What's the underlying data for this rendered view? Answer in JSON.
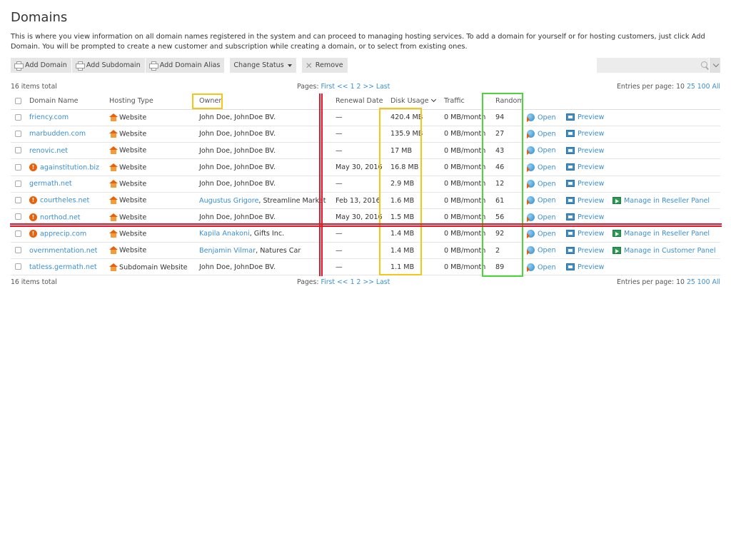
{
  "page": {
    "title": "Domains",
    "description": "This is where you view information on all domain names registered in the system and can proceed to managing hosting services. To add a domain for yourself or for hosting customers, just click Add Domain. You will be prompted to create a new customer and subscription while creating a domain, or to select from existing ones."
  },
  "toolbar": {
    "add_domain": "Add Domain",
    "add_subdomain": "Add Subdomain",
    "add_domain_alias": "Add Domain Alias",
    "change_status": "Change Status",
    "remove": "Remove"
  },
  "search": {
    "placeholder": ""
  },
  "summary": {
    "total": "16 items total",
    "pages_label": "Pages:",
    "first": "First",
    "prev": "<<",
    "page1": "1",
    "page2": "2",
    "next": ">>",
    "last": "Last",
    "entries_label": "Entries per page:",
    "e10": "10",
    "e25": "25",
    "e100": "100",
    "eall": "All"
  },
  "columns": {
    "domain": "Domain Name",
    "hosting": "Hosting Type",
    "owner": "Owner",
    "renewal": "Renewal Date",
    "disk": "Disk Usage",
    "traffic": "Traffic",
    "random": "Random"
  },
  "actions": {
    "open": "Open",
    "preview": "Preview"
  },
  "rows": [
    {
      "domain": "friency.com",
      "alert": false,
      "hosting": "Website",
      "owner_link": "",
      "owner_text": "John Doe, JohnDoe BV.",
      "renewal": "—",
      "disk": "420.4 MB",
      "traffic": "0 MB/month",
      "random": "94",
      "manage": ""
    },
    {
      "domain": "marbudden.com",
      "alert": false,
      "hosting": "Website",
      "owner_link": "",
      "owner_text": "John Doe, JohnDoe BV.",
      "renewal": "—",
      "disk": "135.9 MB",
      "traffic": "0 MB/month",
      "random": "27",
      "manage": ""
    },
    {
      "domain": "renovic.net",
      "alert": false,
      "hosting": "Website",
      "owner_link": "",
      "owner_text": "John Doe, JohnDoe BV.",
      "renewal": "—",
      "disk": "17 MB",
      "traffic": "0 MB/month",
      "random": "43",
      "manage": ""
    },
    {
      "domain": "againstitution.biz",
      "alert": true,
      "hosting": "Website",
      "owner_link": "",
      "owner_text": "John Doe, JohnDoe BV.",
      "renewal": "May 30, 2016",
      "disk": "16.8 MB",
      "traffic": "0 MB/month",
      "random": "46",
      "manage": ""
    },
    {
      "domain": "germath.net",
      "alert": false,
      "hosting": "Website",
      "owner_link": "",
      "owner_text": "John Doe, JohnDoe BV.",
      "renewal": "—",
      "disk": "2.9 MB",
      "traffic": "0 MB/month",
      "random": "12",
      "manage": ""
    },
    {
      "domain": "courtheles.net",
      "alert": true,
      "hosting": "Website",
      "owner_link": "Augustus Grigore",
      "owner_text": ", Streamline Market",
      "renewal": "Feb 13, 2016",
      "disk": "1.6 MB",
      "traffic": "0 MB/month",
      "random": "61",
      "manage": "Manage in Reseller Panel"
    },
    {
      "domain": "northod.net",
      "alert": true,
      "hosting": "Website",
      "owner_link": "",
      "owner_text": "John Doe, JohnDoe BV.",
      "renewal": "May 30, 2016",
      "disk": "1.5 MB",
      "traffic": "0 MB/month",
      "random": "56",
      "manage": ""
    },
    {
      "domain": "apprecip.com",
      "alert": true,
      "hosting": "Website",
      "owner_link": "Kapila Anakoni",
      "owner_text": ", Gifts Inc.",
      "renewal": "—",
      "disk": "1.4 MB",
      "traffic": "0 MB/month",
      "random": "92",
      "manage": "Manage in Reseller Panel"
    },
    {
      "domain": "overnmentation.net",
      "alert": false,
      "hosting": "Website",
      "owner_link": "Benjamin Vilmar",
      "owner_text": ", Natures Car",
      "renewal": "—",
      "disk": "1.4 MB",
      "traffic": "0 MB/month",
      "random": "2",
      "manage": "Manage in Customer Panel"
    },
    {
      "domain": "tatless.germath.net",
      "alert": false,
      "hosting": "Subdomain Website",
      "owner_link": "",
      "owner_text": "John Doe, JohnDoe BV.",
      "renewal": "—",
      "disk": "1.1 MB",
      "traffic": "0 MB/month",
      "random": "89",
      "manage": ""
    }
  ]
}
